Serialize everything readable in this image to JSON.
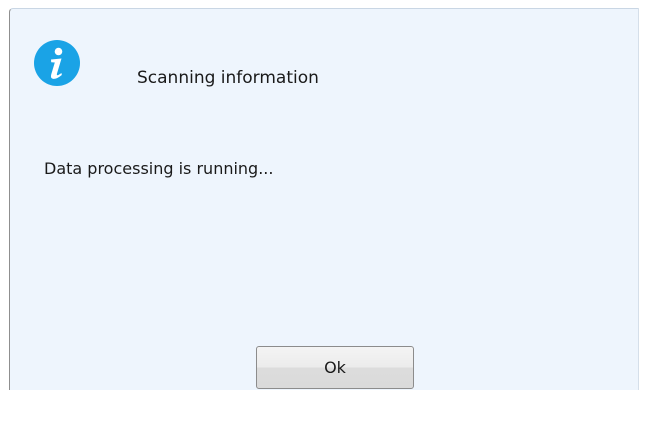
{
  "dialog": {
    "icon": "info-icon",
    "title": "Scanning information",
    "message": "Data processing is running...",
    "ok_label": "Ok"
  },
  "colors": {
    "background": "#eef5fd",
    "icon": "#1aa3e6",
    "text": "#1a1a1a"
  }
}
